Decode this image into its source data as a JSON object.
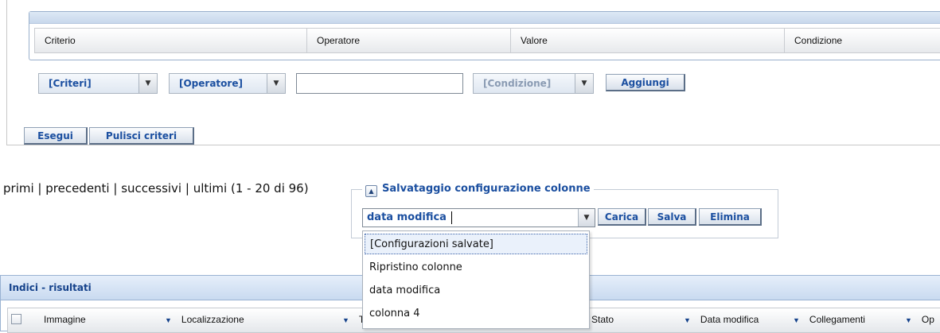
{
  "criteria_table": {
    "columns": [
      "Criterio",
      "Operatore",
      "Valore",
      "Condizione"
    ]
  },
  "criteria_controls": {
    "criteri_select": "[Criteri]",
    "operatore_select": "[Operatore]",
    "valore_input": "",
    "condizione_select": "[Condizione]",
    "aggiungi_button": "Aggiungi"
  },
  "actions": {
    "esegui_button": "Esegui",
    "pulisci_button": "Pulisci criteri"
  },
  "pager": {
    "first": "primi",
    "sep1": " | ",
    "previous": "precedenti",
    "sep2": " | ",
    "next": "successivi",
    "sep3": " | ",
    "last": "ultimi",
    "range": " (1 - 20 di 96)"
  },
  "column_config": {
    "legend": "Salvataggio configurazione colonne",
    "selected_value": "data modifica",
    "carica_button": "Carica",
    "salva_button": "Salva",
    "elimina_button": "Elimina",
    "options": [
      "[Configurazioni salvate]",
      "Ripristino colonne",
      "data modifica",
      "colonna 4"
    ]
  },
  "results": {
    "title": "Indici - risultati",
    "columns": [
      "Immagine",
      "Localizzazione",
      "T",
      "Stato",
      "Data modifica",
      "Collegamenti",
      "Op"
    ]
  },
  "icons": {
    "dropdown": "chevron-down-icon",
    "collapse": "chevron-up-icon",
    "sort": "caret-down-icon"
  },
  "colors": {
    "accent_text": "#1b4fa0",
    "panel_header": "#c9daf0",
    "panel_title": "#15428b"
  }
}
